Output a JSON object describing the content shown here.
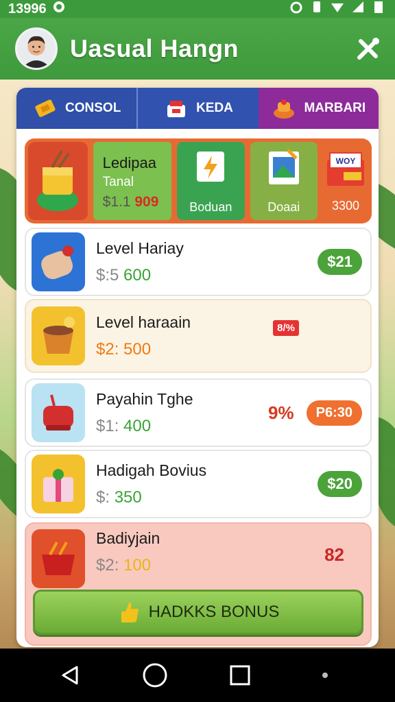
{
  "status_bar": {
    "time": "13996",
    "extra": "0"
  },
  "header": {
    "title": "Uasual Hangn"
  },
  "tabs": [
    {
      "label": "CONSOL"
    },
    {
      "label": "KEDA"
    },
    {
      "label": "MARBARI"
    }
  ],
  "featured": {
    "name": "Ledipaa",
    "sub": "Tanal",
    "price_old": "$1.1",
    "price_new": "909",
    "card1_label": "Boduan",
    "card2_label": "Doaai",
    "last_badge": "WOY",
    "last_value": "3300"
  },
  "items": [
    {
      "name": "Level Hariay",
      "price_prefix": "$:5",
      "price": "600",
      "action": "$21"
    },
    {
      "name": "Level haraain",
      "price_prefix": "$2:",
      "price": "500",
      "badge": "8/%"
    },
    {
      "name": "Payahin Tghe",
      "price_prefix": "$1:",
      "price": "400",
      "pct": "9%",
      "action": "P6:30"
    },
    {
      "name": "Hadigah Bovius",
      "price_prefix": "$:",
      "price": "350",
      "action": "$20"
    },
    {
      "name": "Badiyjain",
      "price_prefix": "$2:",
      "price": "100",
      "value": "82"
    }
  ],
  "bonus_button": {
    "label": "HADKKS BONUS"
  },
  "colors": {
    "header_green": "#3f9a3d",
    "accent_green": "#4ba33a",
    "accent_orange": "#f0702f",
    "tab_blue": "#2f4fa8",
    "tab_purple": "#8d2b9a"
  }
}
